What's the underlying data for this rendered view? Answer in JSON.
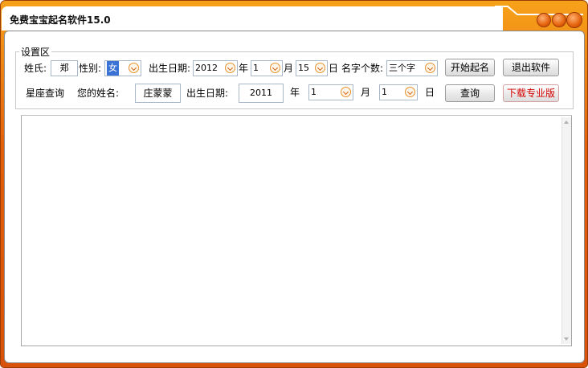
{
  "window": {
    "title": "免费宝宝起名软件15.0",
    "accent_color": "#e8650e"
  },
  "settings": {
    "group_label": "设置区",
    "surname_label": "姓氏:",
    "surname_value": "郑",
    "gender_label": "性别:",
    "gender_value": "女",
    "birth_label": "出生日期:",
    "year_value": "2012",
    "year_unit": "年",
    "month_value": "1",
    "month_unit": "月",
    "day_value": "15",
    "day_unit": "日",
    "name_len_label": "名字个数:",
    "name_len_value": "三个字",
    "start_button": "开始起名",
    "exit_button": "退出软件"
  },
  "horoscope": {
    "section_label": "星座查询",
    "name_label": "您的姓名:",
    "name_value": "庄蒙蒙",
    "birth_label": "出生日期:",
    "year_value": "2011",
    "year_unit": "年",
    "month_value": "1",
    "month_unit": "月",
    "day_value": "1",
    "day_unit": "日",
    "query_button": "查询",
    "pro_button": "下载专业版"
  },
  "output": {
    "content": ""
  }
}
